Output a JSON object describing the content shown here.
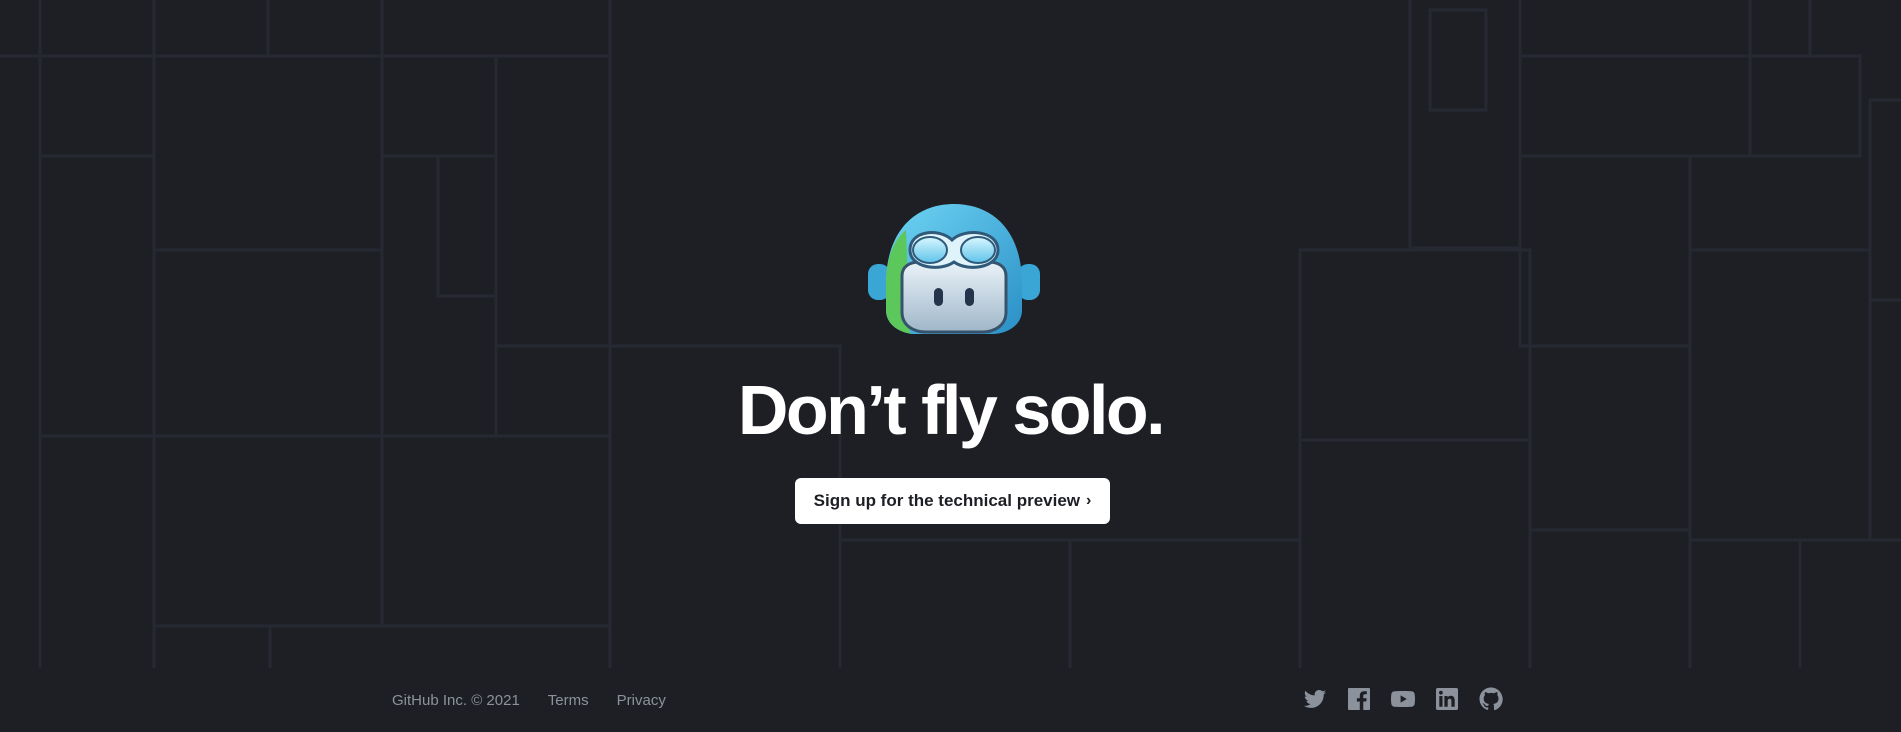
{
  "hero": {
    "mascot_icon": "copilot-pilot-mascot",
    "headline": "Don’t fly solo.",
    "cta_label": "Sign up for the technical preview",
    "cta_chevron": "›"
  },
  "footer": {
    "copyright": "GitHub Inc. © 2021",
    "links": [
      "Terms",
      "Privacy"
    ],
    "social_icons": [
      "twitter-icon",
      "facebook-icon",
      "youtube-icon",
      "linkedin-icon",
      "github-icon"
    ]
  },
  "colors": {
    "background": "#1d1f25",
    "grid_lines": "#262932",
    "headline": "#ffffff",
    "button_bg": "#ffffff",
    "button_text": "#1d1f25",
    "footer_text": "#8b929c"
  }
}
